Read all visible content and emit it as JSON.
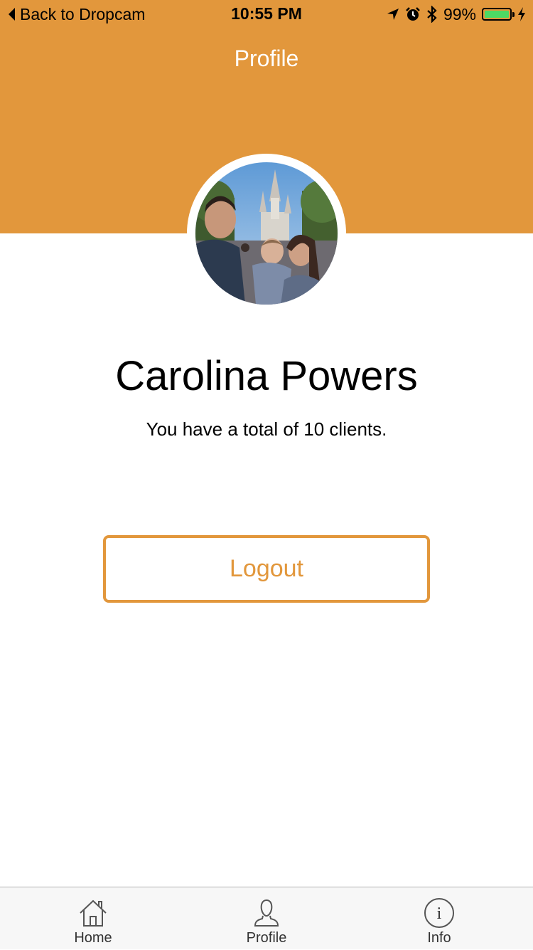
{
  "status_bar": {
    "back_label": "Back to Dropcam",
    "time": "10:55 PM",
    "battery_percent": "99%",
    "battery_level": 0.99,
    "icons": [
      "location-arrow-icon",
      "alarm-icon",
      "bluetooth-icon",
      "battery-icon",
      "charging-bolt-icon"
    ]
  },
  "nav": {
    "title": "Profile"
  },
  "profile": {
    "name": "Carolina Powers",
    "clients_text": "You have a total of 10 clients.",
    "avatar_icon": "profile-photo"
  },
  "actions": {
    "logout_label": "Logout"
  },
  "tab_bar": {
    "tabs": [
      {
        "label": "Home",
        "icon": "home-icon"
      },
      {
        "label": "Profile",
        "icon": "person-icon"
      },
      {
        "label": "Info",
        "icon": "info-icon"
      }
    ]
  },
  "colors": {
    "accent": "#E2973C",
    "battery_fill": "#4CD964",
    "tab_bar_bg": "#F7F7F7"
  }
}
